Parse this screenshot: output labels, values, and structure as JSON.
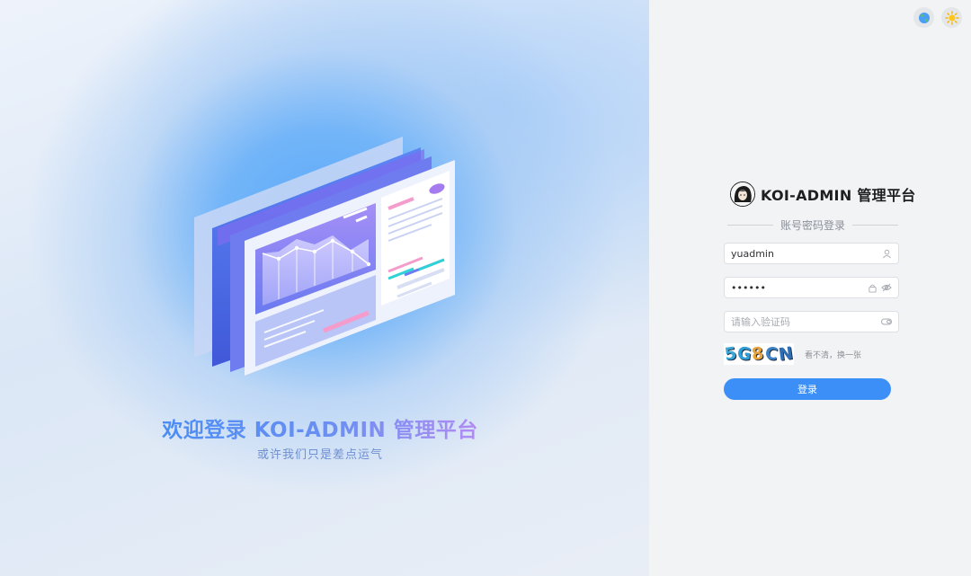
{
  "hero": {
    "title": "欢迎登录 KOI-ADMIN 管理平台",
    "subtitle": "或许我们只是差点运气"
  },
  "topbar": {
    "language_icon": "globe-icon",
    "theme_icon": "sun-icon"
  },
  "brand": {
    "name": "KOI-ADMIN 管理平台",
    "logo_icon": "avatar-logo"
  },
  "login": {
    "section_title": "账号密码登录",
    "username": {
      "value": "yuadmin",
      "icon": "user-icon"
    },
    "password": {
      "value": "••••••",
      "icon": "lock-icon",
      "toggle_icon": "eye-icon"
    },
    "captcha": {
      "placeholder": "请输入验证码",
      "icon": "toggle-icon"
    },
    "captcha_image_text": "5G8CN",
    "refresh_text": "看不清，换一张",
    "submit_label": "登录"
  },
  "colors": {
    "primary": "#3b8ff6",
    "panel_bg": "#f2f3f5",
    "hero_blue": "#5aa9fb"
  }
}
